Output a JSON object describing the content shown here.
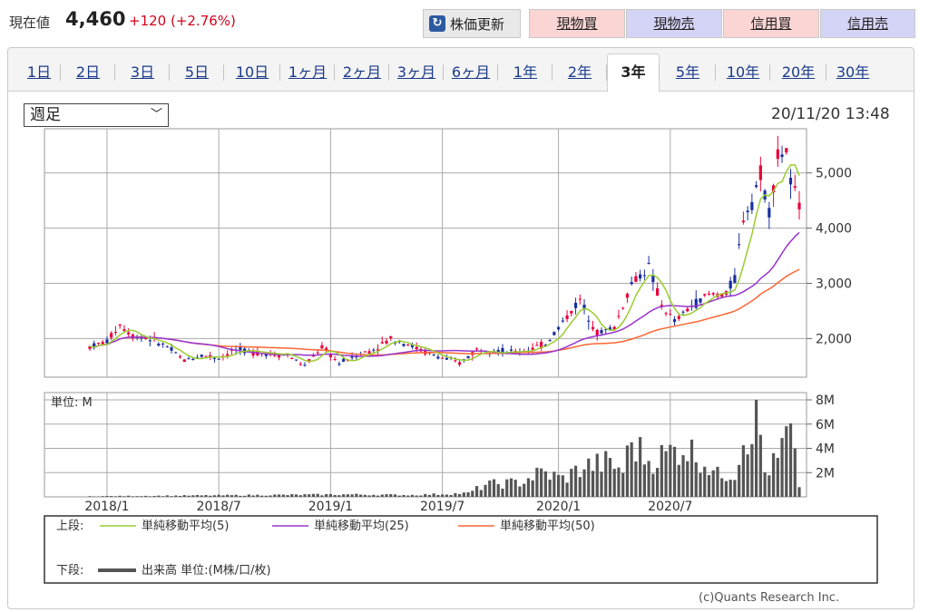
{
  "header": {
    "price_label": "現在値",
    "price_value": "4,460",
    "price_change": "+120 (+2.76%)",
    "refresh_label": "株価更新",
    "buttons": [
      "現物買",
      "現物売",
      "信用買",
      "信用売"
    ]
  },
  "tabs": [
    "1日",
    "2日",
    "3日",
    "5日",
    "10日",
    "1ヶ月",
    "2ヶ月",
    "3ヶ月",
    "6ヶ月",
    "1年",
    "2年",
    "3年",
    "5年",
    "10年",
    "20年",
    "30年"
  ],
  "active_tab": "3年",
  "select": {
    "value": "週足"
  },
  "timestamp": "20/11/20 13:48",
  "credit": "(c)Quants Research Inc.",
  "colors": {
    "up": "#e8003c",
    "down": "#1a2fa0",
    "ma5": "#9acd32",
    "ma25": "#9933cc",
    "ma50": "#ff6633",
    "volume": "#555555"
  },
  "chart_data": [
    {
      "type": "candlestick",
      "price_ticks": [
        "5,000",
        "4,000",
        "3,000",
        "2,000"
      ],
      "ylim": [
        1300,
        5800
      ],
      "x_tick_labels": [
        "2018/1",
        "2018/7",
        "2019/1",
        "2019/7",
        "2020/1",
        "2020/7"
      ],
      "anchor_prices": [
        [
          0,
          1850
        ],
        [
          4,
          1950
        ],
        [
          7,
          2250
        ],
        [
          10,
          2050
        ],
        [
          14,
          2000
        ],
        [
          18,
          1850
        ],
        [
          22,
          1600
        ],
        [
          26,
          1700
        ],
        [
          30,
          1650
        ],
        [
          34,
          1800
        ],
        [
          38,
          1750
        ],
        [
          42,
          1720
        ],
        [
          46,
          1700
        ],
        [
          50,
          1500
        ],
        [
          54,
          1850
        ],
        [
          58,
          1550
        ],
        [
          62,
          1700
        ],
        [
          66,
          1800
        ],
        [
          70,
          2000
        ],
        [
          74,
          1900
        ],
        [
          78,
          1750
        ],
        [
          82,
          1650
        ],
        [
          86,
          1550
        ],
        [
          90,
          1800
        ],
        [
          94,
          1800
        ],
        [
          98,
          1750
        ],
        [
          102,
          1800
        ],
        [
          106,
          1900
        ],
        [
          110,
          2300
        ],
        [
          114,
          2700
        ],
        [
          118,
          2100
        ],
        [
          122,
          2200
        ],
        [
          126,
          3000
        ],
        [
          130,
          3300
        ],
        [
          133,
          2600
        ],
        [
          136,
          2300
        ],
        [
          140,
          2600
        ],
        [
          144,
          2800
        ],
        [
          148,
          2800
        ],
        [
          150,
          3100
        ],
        [
          152,
          4200
        ],
        [
          154,
          4500
        ],
        [
          156,
          5000
        ],
        [
          158,
          4300
        ],
        [
          160,
          5300
        ],
        [
          162,
          5400
        ],
        [
          163,
          4800
        ],
        [
          165,
          4460
        ]
      ],
      "ma5_label": "単純移動平均(5)",
      "ma25_label": "単純移動平均(25)",
      "ma50_label": "単純移動平均(50)"
    },
    {
      "type": "bar",
      "unit_label": "単位: M",
      "y_ticks": [
        "8M",
        "6M",
        "4M",
        "2M"
      ],
      "ylim": [
        0,
        8
      ],
      "volume_anchors": [
        [
          0,
          0.05
        ],
        [
          20,
          0.1
        ],
        [
          40,
          0.15
        ],
        [
          60,
          0.2
        ],
        [
          75,
          0.15
        ],
        [
          88,
          0.3
        ],
        [
          92,
          1.0
        ],
        [
          100,
          1.2
        ],
        [
          105,
          2.0
        ],
        [
          110,
          1.5
        ],
        [
          115,
          2.5
        ],
        [
          120,
          2.8
        ],
        [
          124,
          2.2
        ],
        [
          126,
          4.5
        ],
        [
          130,
          3.0
        ],
        [
          134,
          3.5
        ],
        [
          138,
          4.2
        ],
        [
          142,
          3.2
        ],
        [
          146,
          1.8
        ],
        [
          150,
          2.0
        ],
        [
          152,
          5.0
        ],
        [
          154,
          5.8
        ],
        [
          155,
          8.0
        ],
        [
          157,
          2.0
        ],
        [
          160,
          3.0
        ],
        [
          162,
          5.0
        ],
        [
          163,
          4.8
        ],
        [
          165,
          1.0
        ]
      ],
      "volume_label": "出来高 単位:(M株/口/枚)"
    }
  ],
  "legend": {
    "upper_label": "上段:",
    "lower_label": "下段:"
  }
}
